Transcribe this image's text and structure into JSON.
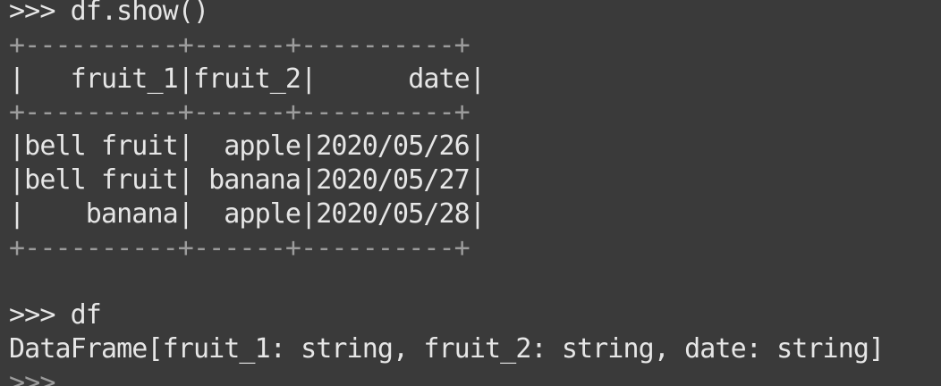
{
  "terminal": {
    "lines": [
      {
        "kind": "prompt",
        "text": ">>> df.show()"
      },
      {
        "kind": "border",
        "text": "+----------+------+----------+"
      },
      {
        "kind": "row",
        "text": "|   fruit_1|fruit_2|      date|"
      },
      {
        "kind": "border",
        "text": "+----------+------+----------+"
      },
      {
        "kind": "row",
        "text": "|bell fruit|  apple|2020/05/26|"
      },
      {
        "kind": "row",
        "text": "|bell fruit| banana|2020/05/27|"
      },
      {
        "kind": "row",
        "text": "|    banana|  apple|2020/05/28|"
      },
      {
        "kind": "border",
        "text": "+----------+------+----------+"
      },
      {
        "kind": "blank",
        "text": ""
      },
      {
        "kind": "prompt",
        "text": ">>> df"
      },
      {
        "kind": "output",
        "text": "DataFrame[fruit_1: string, fruit_2: string, date: string]"
      },
      {
        "kind": "cut",
        "text": ">>>"
      }
    ]
  }
}
